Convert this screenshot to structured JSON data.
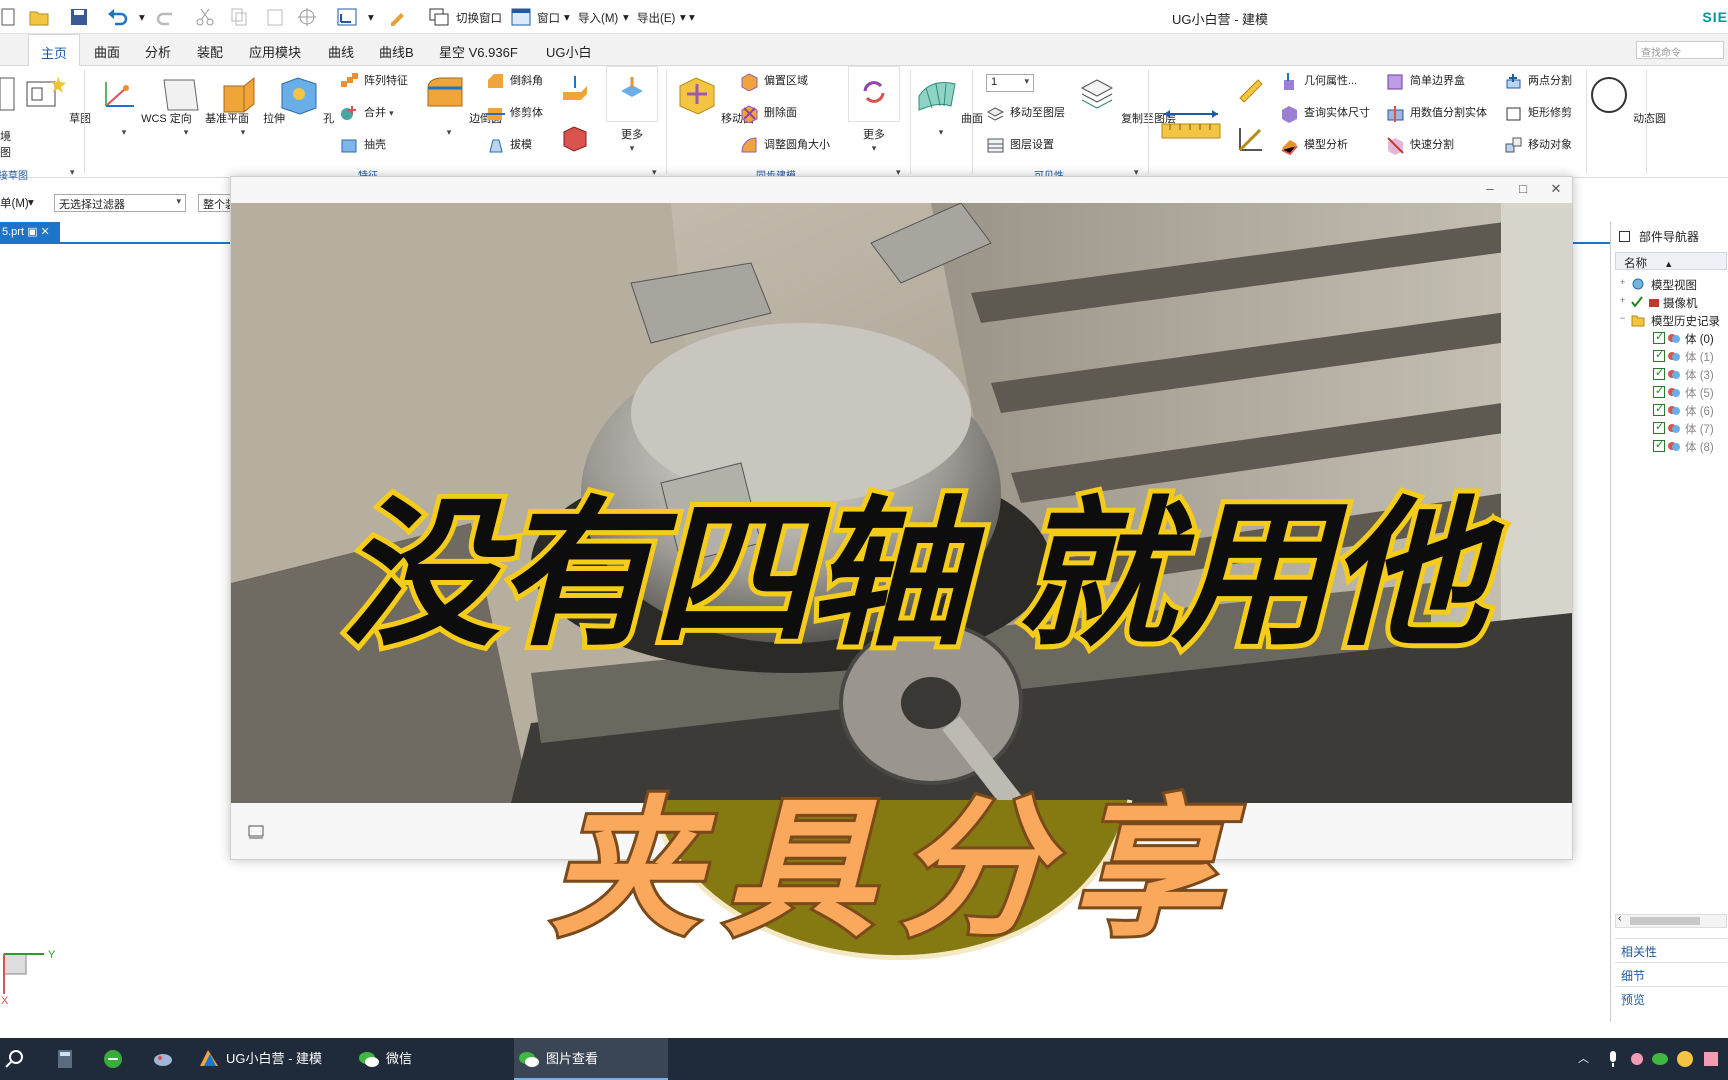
{
  "app": {
    "title": "UG小白营 - 建模",
    "brand": "SIE"
  },
  "quick_access": {
    "switch_window": "切换窗口",
    "window": "窗口",
    "import": "导入(M)",
    "export": "导出(E)"
  },
  "tabs": [
    "主页",
    "曲面",
    "分析",
    "装配",
    "应用模块",
    "曲线",
    "曲线B",
    "星空 V6.936F",
    "UG小白"
  ],
  "active_tab": "主页",
  "cmd_search_placeholder": "查找命令",
  "ribbon": {
    "env": "境",
    "env2": "图",
    "sketch": "草图",
    "sketch_group": "接草图",
    "wcs": "WCS 定向",
    "datum_plane": "基准平面",
    "extrude": "拉伸",
    "hole": "孔",
    "array_feature": "阵列特征",
    "unite": "合并",
    "shell": "抽壳",
    "edge_blend": "边倒圆",
    "chamfer": "倒斜角",
    "trim_body": "修剪体",
    "draft": "拔模",
    "more": "更多",
    "feature_group": "特征",
    "move_face": "移动面",
    "offset_region": "偏置区域",
    "delete_face": "删除面",
    "resize_blend": "调整圆角大小",
    "more2": "更多",
    "sync_group": "同步建模",
    "surface": "曲面",
    "layer_value": "1",
    "move_to_layer": "移动至图层",
    "layer_settings": "图层设置",
    "copy_to_layer": "复制至图层",
    "visible_group": "可见性",
    "geom_props": "几何属性...",
    "measure_body": "查询实体尺寸",
    "model_analysis": "模型分析",
    "simple_bbox": "简单边界盒",
    "split_by_value": "用数值分割实体",
    "quick_split": "快速分割",
    "two_point_split": "两点分割",
    "rect_trim": "矩形修剪",
    "move_object": "移动对象",
    "dynamic_circle": "动态圆"
  },
  "filter_row": {
    "type_label": "单(M)",
    "filter": "无选择过滤器",
    "assembly": "整个装"
  },
  "doc_tab": "5.prt",
  "navigator": {
    "title": "部件导航器",
    "column": "名称",
    "rows": [
      {
        "label": "模型视图",
        "dim": false
      },
      {
        "label": "摄像机",
        "dim": false
      },
      {
        "label": "模型历史记录",
        "dim": false
      },
      {
        "label": "体 (0)",
        "dim": false
      },
      {
        "label": "体 (1)",
        "dim": true
      },
      {
        "label": "体 (3)",
        "dim": true
      },
      {
        "label": "体 (5)",
        "dim": true
      },
      {
        "label": "体 (6)",
        "dim": true
      },
      {
        "label": "体 (7)",
        "dim": true
      },
      {
        "label": "体 (8)",
        "dim": true
      }
    ],
    "panes": [
      "相关性",
      "细节",
      "预览"
    ]
  },
  "viewer": {
    "headline": "没有四轴 就用他",
    "subheadline": "夹具分享"
  },
  "triad": {
    "y": "Y",
    "x": "X"
  },
  "taskbar": {
    "items": [
      "UG小白营 - 建模",
      "微信",
      "图片查看"
    ]
  },
  "colors": {
    "accent": "#1e74c8",
    "headline_outline": "#f6cc1a",
    "subheadline_fill": "#f9a85c",
    "olive": "#857a12",
    "taskbar": "#1f2a3a"
  }
}
